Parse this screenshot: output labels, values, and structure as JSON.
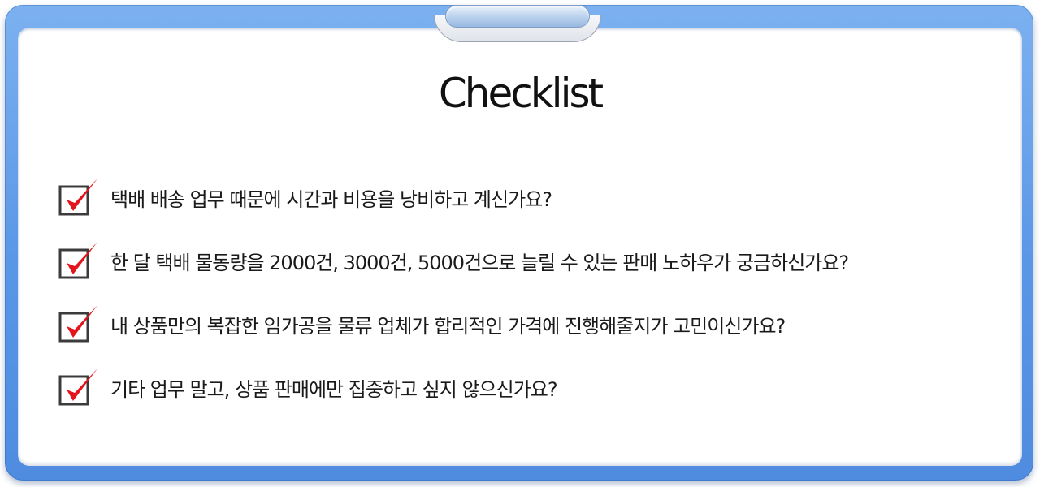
{
  "title": "Checklist",
  "items": [
    {
      "text": "택배 배송 업무 때문에 시간과 비용을 낭비하고 계신가요?",
      "checked": true
    },
    {
      "text": "한 달 택배 물동량을 2000건, 3000건, 5000건으로 늘릴 수 있는 판매 노하우가 궁금하신가요?",
      "checked": true
    },
    {
      "text": "내 상품만의 복잡한 임가공을 물류 업체가 합리적인 가격에 진행해줄지가 고민이신가요?",
      "checked": true
    },
    {
      "text": "기타 업무 말고, 상품 판매에만 집중하고 싶지 않으신가요?",
      "checked": true
    }
  ],
  "colors": {
    "board": "#5a96e6",
    "check": "#e3141c",
    "box_border": "#3b3b3b"
  },
  "icons": [
    "clipboard-clip-icon",
    "checkbox-checked-icon"
  ]
}
